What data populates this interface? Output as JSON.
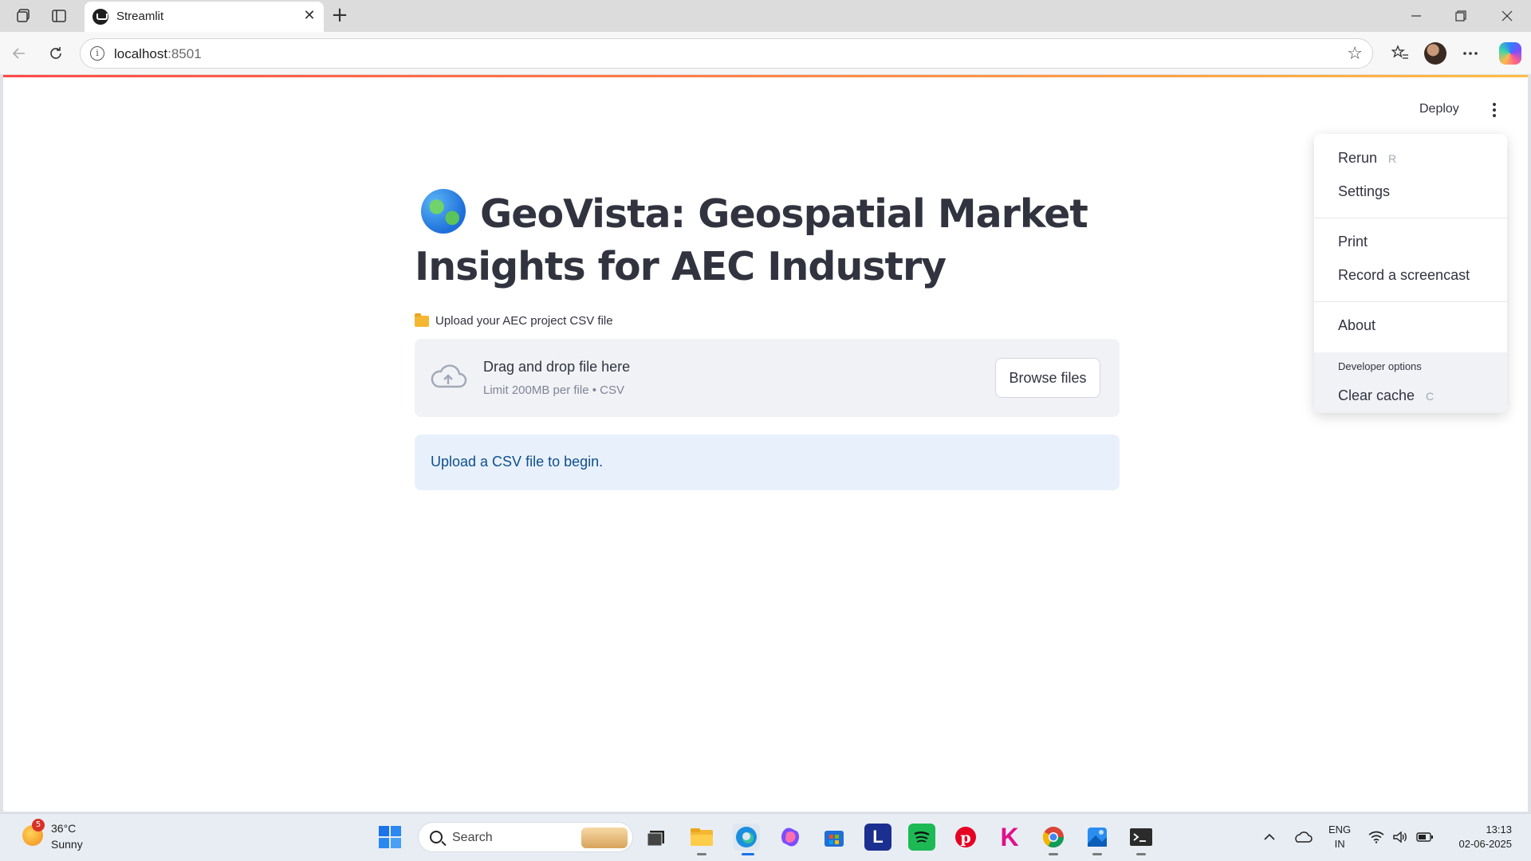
{
  "browser": {
    "tab_title": "Streamlit",
    "url_host": "localhost",
    "url_port": ":8501"
  },
  "app": {
    "deploy_label": "Deploy",
    "title": "GeoVista: Geospatial Market Insights for AEC Industry",
    "uploader": {
      "label": "Upload your AEC project CSV file",
      "drop_text": "Drag and drop file here",
      "limit_text": "Limit 200MB per file • CSV",
      "browse_label": "Browse files"
    },
    "info_message": "Upload a CSV file to begin."
  },
  "menu": {
    "rerun": "Rerun",
    "rerun_shortcut": "R",
    "settings": "Settings",
    "print": "Print",
    "record": "Record a screencast",
    "about": "About",
    "dev_label": "Developer options",
    "clear_cache": "Clear cache",
    "clear_cache_shortcut": "C"
  },
  "taskbar": {
    "weather_badge": "5",
    "weather_temp": "36°C",
    "weather_cond": "Sunny",
    "search_placeholder": "Search",
    "lang_top": "ENG",
    "lang_bottom": "IN",
    "time": "13:13",
    "date": "02-06-2025"
  },
  "colors": {
    "accent_red": "#ff4b4b",
    "info_bg": "#e8f1fb",
    "info_text": "#0f4e8c"
  }
}
